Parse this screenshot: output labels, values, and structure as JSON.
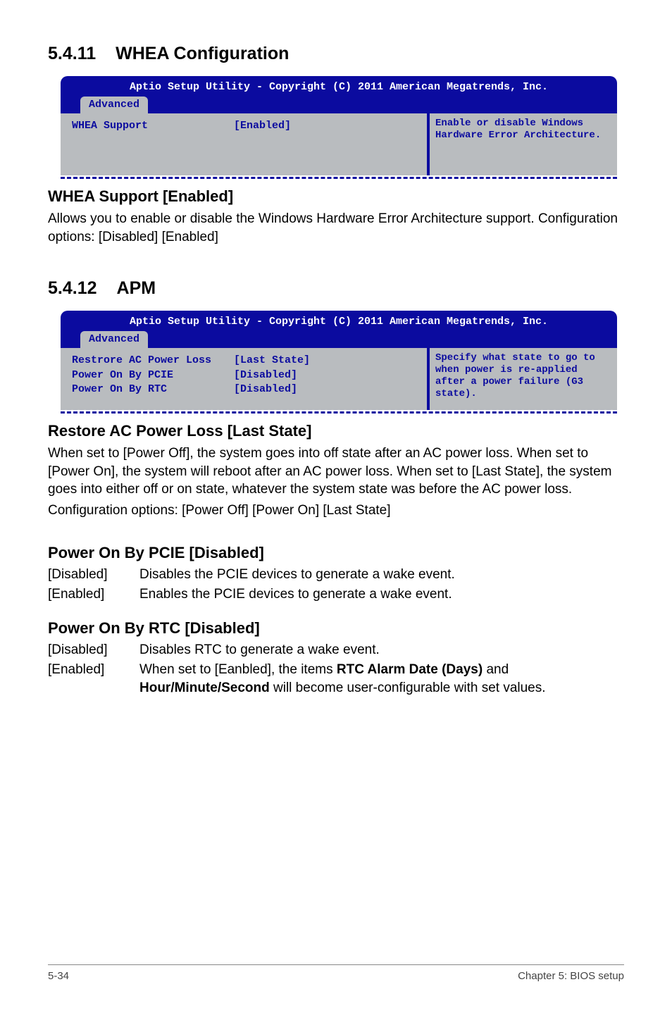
{
  "section1": {
    "number": "5.4.11",
    "title": "WHEA Configuration",
    "bios": {
      "header": "Aptio Setup Utility - Copyright (C) 2011 American Megatrends, Inc.",
      "tab": "Advanced",
      "rows": [
        {
          "label": "WHEA Support",
          "value": "[Enabled]"
        }
      ],
      "help": "Enable or disable Windows Hardware Error Architecture."
    },
    "sub1": {
      "heading": "WHEA Support [Enabled]",
      "p1": "Allows you to enable or disable the Windows Hardware Error Architecture support. Configuration options: [Disabled] [Enabled]"
    }
  },
  "section2": {
    "number": "5.4.12",
    "title": "APM",
    "bios": {
      "header": "Aptio Setup Utility - Copyright (C) 2011 American Megatrends, Inc.",
      "tab": "Advanced",
      "rows": [
        {
          "label": "Restrore AC Power Loss",
          "value": "[Last State]"
        },
        {
          "label": "Power On By PCIE",
          "value": "[Disabled]"
        },
        {
          "label": "Power On By RTC",
          "value": "[Disabled]"
        }
      ],
      "help": "Specify what state to go to when power is re-applied after a power failure (G3 state)."
    },
    "sub1": {
      "heading": "Restore AC Power Loss [Last State]",
      "p1": "When set to [Power Off], the system goes into off state after an AC power loss. When set to [Power On], the system will reboot after an AC power loss. When set to [Last State], the system goes into either off or on state, whatever the system state was before the AC power loss.",
      "p2": "Configuration options: [Power Off] [Power On] [Last State]"
    },
    "sub2": {
      "heading": "Power On By PCIE [Disabled]",
      "options": [
        {
          "key": "[Disabled]",
          "val": "Disables the PCIE devices to generate a wake event."
        },
        {
          "key": "[Enabled]",
          "val": "Enables the PCIE devices to generate a wake event."
        }
      ]
    },
    "sub3": {
      "heading": "Power On By RTC [Disabled]",
      "options": [
        {
          "key": "[Disabled]",
          "val": "Disables RTC to generate a wake event."
        },
        {
          "key": "[Enabled]",
          "val_pre": "When set to [Eanbled], the items ",
          "val_b1": "RTC Alarm Date (Days)",
          "val_mid": " and ",
          "val_b2": "Hour/Minute/Second",
          "val_post": " will become user-configurable with set values."
        }
      ]
    }
  },
  "footer": {
    "left": "5-34",
    "right": "Chapter 5: BIOS setup"
  }
}
